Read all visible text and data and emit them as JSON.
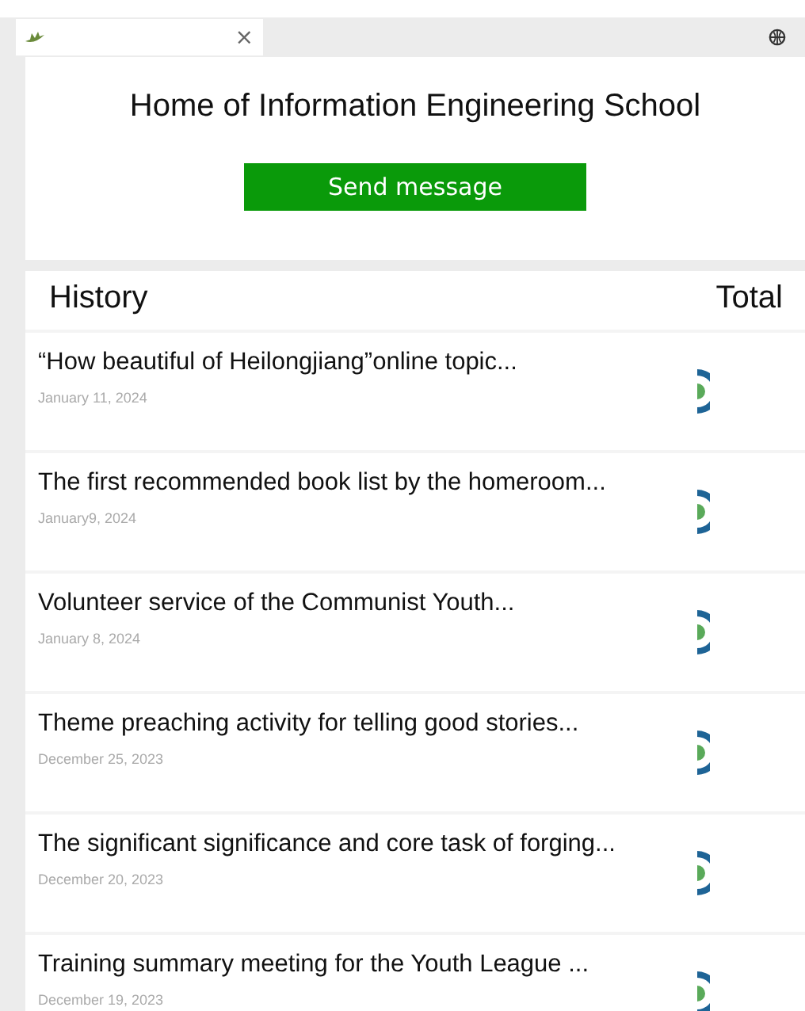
{
  "browser_tab": {
    "close": "×"
  },
  "header": {
    "title": "Home of Information Engineering School",
    "button": "Send message"
  },
  "history": {
    "title": "History",
    "total": "Total"
  },
  "items": [
    {
      "title": "“How beautiful of Heilongjiang”online topic...",
      "date": "January 11, 2024"
    },
    {
      "title": "The first recommended book list by the homeroom...",
      "date": "January9, 2024"
    },
    {
      "title": "Volunteer service of the Communist Youth...",
      "date": "January 8, 2024"
    },
    {
      "title": "Theme preaching activity for telling good stories...",
      "date": "December 25, 2023"
    },
    {
      "title": "The significant significance and core task of forging...",
      "date": "December 20, 2023"
    },
    {
      "title": "Training summary meeting for the Youth League ...",
      "date": "December 19, 2023"
    }
  ]
}
